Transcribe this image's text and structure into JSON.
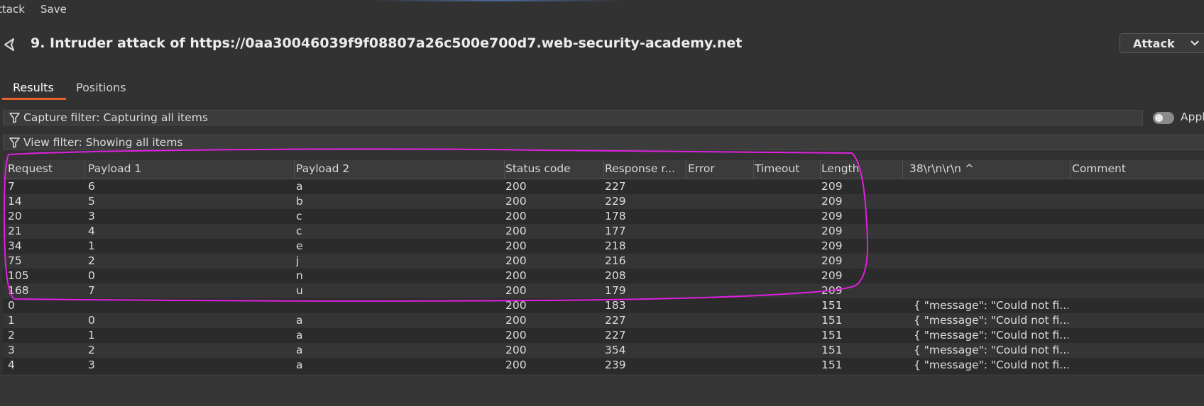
{
  "menu": {
    "attack": "ttack",
    "save": "Save"
  },
  "header": {
    "title": "9. Intruder attack of https://0aa30046039f9f08807a26c500e700d7.web-security-academy.net",
    "attack_button": "Attack"
  },
  "tabs": [
    {
      "label": "Results",
      "active": true
    },
    {
      "label": "Positions",
      "active": false
    }
  ],
  "capture_filter": {
    "text": "Capture filter: Capturing all items",
    "toggle_label": "Appl"
  },
  "view_filter": {
    "text": "View filter: Showing all items"
  },
  "table": {
    "columns": [
      "Request",
      "Payload 1",
      "Payload 2",
      "Status code",
      "Response r...",
      "Error",
      "Timeout",
      "Length",
      "38\\r\\n\\r\\n ^",
      "Comment"
    ],
    "rows": [
      [
        "7",
        "6",
        "a",
        "200",
        "227",
        "",
        "",
        "209",
        "",
        ""
      ],
      [
        "14",
        "5",
        "b",
        "200",
        "229",
        "",
        "",
        "209",
        "",
        ""
      ],
      [
        "20",
        "3",
        "c",
        "200",
        "178",
        "",
        "",
        "209",
        "",
        ""
      ],
      [
        "21",
        "4",
        "c",
        "200",
        "177",
        "",
        "",
        "209",
        "",
        ""
      ],
      [
        "34",
        "1",
        "e",
        "200",
        "218",
        "",
        "",
        "209",
        "",
        ""
      ],
      [
        "75",
        "2",
        "j",
        "200",
        "216",
        "",
        "",
        "209",
        "",
        ""
      ],
      [
        "105",
        "0",
        "n",
        "200",
        "208",
        "",
        "",
        "209",
        "",
        ""
      ],
      [
        "168",
        "7",
        "u",
        "200",
        "179",
        "",
        "",
        "209",
        "",
        ""
      ],
      [
        "0",
        "",
        "",
        "200",
        "183",
        "",
        "",
        "151",
        "{   \"message\": \"Could not fi...",
        ""
      ],
      [
        "1",
        "0",
        "a",
        "200",
        "227",
        "",
        "",
        "151",
        "{   \"message\": \"Could not fi...",
        ""
      ],
      [
        "2",
        "1",
        "a",
        "200",
        "227",
        "",
        "",
        "151",
        "{   \"message\": \"Could not fi...",
        ""
      ],
      [
        "3",
        "2",
        "a",
        "200",
        "354",
        "",
        "",
        "151",
        "{   \"message\": \"Could not fi...",
        ""
      ],
      [
        "4",
        "3",
        "a",
        "200",
        "239",
        "",
        "",
        "151",
        "{   \"message\": \"Could not fi...",
        ""
      ]
    ]
  },
  "colors": {
    "accent": "#e8632b",
    "annotation": "#e020e0"
  }
}
